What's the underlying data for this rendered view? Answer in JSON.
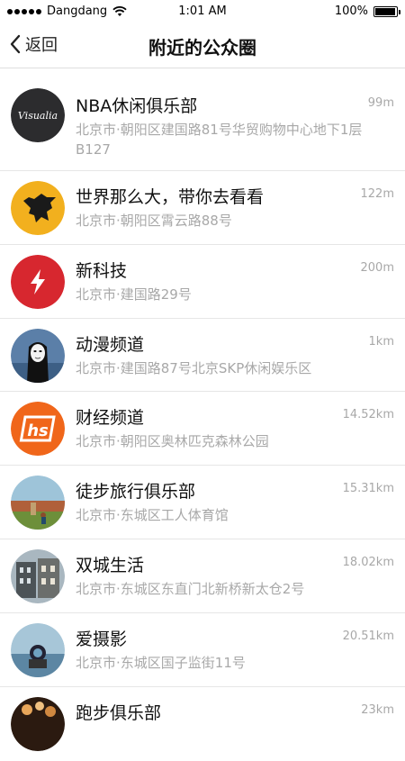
{
  "status_bar": {
    "carrier": "Dangdang",
    "time": "1:01 AM",
    "battery": "100%",
    "battery_level": 1.0
  },
  "nav": {
    "back_label": "返回",
    "title": "附近的公众圈"
  },
  "items": [
    {
      "name": "NBA休闲俱乐部",
      "distance": "99m",
      "address": "北京市·朝阳区建国路81号华贸购物中心地下1层B127",
      "avatar_text": "Visualia",
      "avatar_color": "#2c2c2e"
    },
    {
      "name": "世界那么大，带你去看看",
      "distance": "122m",
      "address": "北京市·朝阳区霄云路88号",
      "avatar_color": "#f2b01e"
    },
    {
      "name": "新科技",
      "distance": "200m",
      "address": "北京市·建国路29号",
      "avatar_color": "#d7272f"
    },
    {
      "name": "动漫频道",
      "distance": "1km",
      "address": "北京市·建国路87号北京SKP休闲娱乐区",
      "avatar_color": "#5b7fa8"
    },
    {
      "name": "财经频道",
      "distance": "14.52km",
      "address": "北京市·朝阳区奥林匹克森林公园",
      "avatar_text": "hs",
      "avatar_color": "#f0661a"
    },
    {
      "name": "徒步旅行俱乐部",
      "distance": "15.31km",
      "address": "北京市·东城区工人体育馆",
      "avatar_color": "#9ec4d9"
    },
    {
      "name": "双城生活",
      "distance": "18.02km",
      "address": "北京市·东城区东直门北新桥新太仓2号",
      "avatar_color": "#7f8c8d"
    },
    {
      "name": "爱摄影",
      "distance": "20.51km",
      "address": "北京市·东城区国子监街11号",
      "avatar_color": "#6fa1c0"
    },
    {
      "name": "跑步俱乐部",
      "distance": "23km",
      "address": "",
      "avatar_color": "#2b1a10"
    }
  ]
}
